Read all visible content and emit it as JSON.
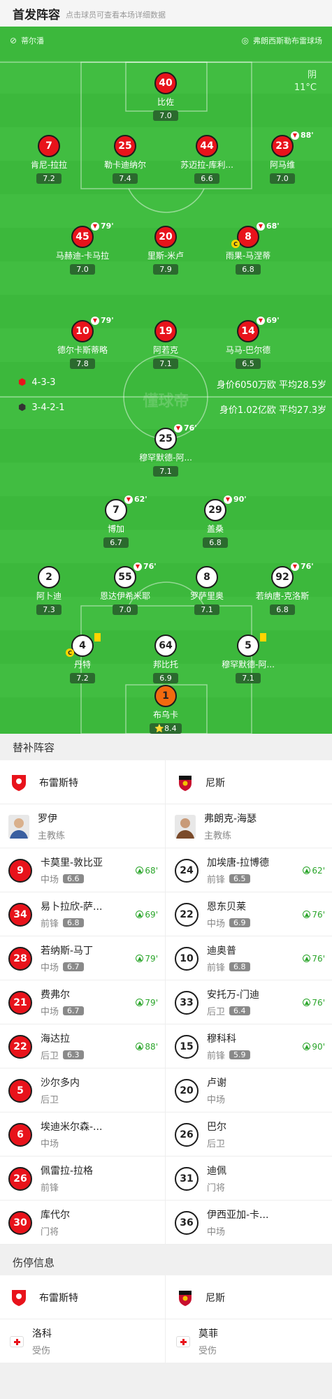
{
  "header": {
    "title": "首发阵容",
    "subtitle": "点击球员可查看本场详细数据"
  },
  "field": {
    "home_team": "蒂尔潘",
    "venue": "弗朗西斯勒布雷球场",
    "weather": "阴",
    "temperature": "11°C",
    "watermark": "懂球帝",
    "home_formation": "4-3-3",
    "home_value": "身价6050万欧 平均28.5岁",
    "away_formation": "3-4-2-1",
    "away_value": "身价1.02亿欧 平均27.3岁"
  },
  "home_players": [
    {
      "num": "40",
      "name": "比佐",
      "rating": "7.0",
      "sub": ""
    },
    {
      "num": "7",
      "name": "肯尼-拉拉",
      "rating": "7.2",
      "sub": ""
    },
    {
      "num": "25",
      "name": "勒卡迪纳尔",
      "rating": "7.4",
      "sub": ""
    },
    {
      "num": "44",
      "name": "苏迈拉-库利...",
      "rating": "6.6",
      "sub": ""
    },
    {
      "num": "23",
      "name": "阿马维",
      "rating": "7.0",
      "sub": "88'"
    },
    {
      "num": "45",
      "name": "马赫迪-卡马拉",
      "rating": "7.0",
      "sub": "79'"
    },
    {
      "num": "20",
      "name": "里斯-米卢",
      "rating": "7.9",
      "sub": ""
    },
    {
      "num": "8",
      "name": "雨果-马涅蒂",
      "rating": "6.8",
      "sub": "68'"
    },
    {
      "num": "10",
      "name": "德尔卡斯蒂略",
      "rating": "7.8",
      "sub": "79'"
    },
    {
      "num": "19",
      "name": "阿若克",
      "rating": "7.1",
      "sub": ""
    },
    {
      "num": "14",
      "name": "马马-巴尔德",
      "rating": "6.5",
      "sub": "69'"
    }
  ],
  "away_players": [
    {
      "num": "25",
      "name": "穆罕默德-阿...",
      "rating": "7.1",
      "sub": "76'"
    },
    {
      "num": "7",
      "name": "博加",
      "rating": "6.7",
      "sub": "62'"
    },
    {
      "num": "29",
      "name": "盖桑",
      "rating": "6.8",
      "sub": "90'"
    },
    {
      "num": "2",
      "name": "阿卜迪",
      "rating": "7.3",
      "sub": ""
    },
    {
      "num": "55",
      "name": "恩达伊希米耶",
      "rating": "7.0",
      "sub": "76'"
    },
    {
      "num": "8",
      "name": "罗萨里奥",
      "rating": "7.1",
      "sub": ""
    },
    {
      "num": "92",
      "name": "若纳唐-克洛斯",
      "rating": "6.8",
      "sub": "76'"
    },
    {
      "num": "4",
      "name": "丹特",
      "rating": "7.2",
      "sub": ""
    },
    {
      "num": "64",
      "name": "邦比托",
      "rating": "6.9",
      "sub": ""
    },
    {
      "num": "5",
      "name": "穆罕默德-阿...",
      "rating": "7.1",
      "sub": ""
    },
    {
      "num": "1",
      "name": "布乌卡",
      "rating": "8.4",
      "sub": ""
    }
  ],
  "subs": {
    "title": "替补阵容",
    "home_team": "布雷斯特",
    "away_team": "尼斯",
    "home_coach": {
      "name": "罗伊",
      "role": "主教练"
    },
    "away_coach": {
      "name": "弗朗克-海瑟",
      "role": "主教练"
    },
    "rows": [
      {
        "hn": "9",
        "hname": "卡莫里-敦比亚",
        "hpos": "中场",
        "hr": "6.6",
        "hs": "68'",
        "an": "24",
        "aname": "加埃唐-拉博德",
        "apos": "前锋",
        "ar": "6.5",
        "as": "62'"
      },
      {
        "hn": "34",
        "hname": "易卜拉欣-萨...",
        "hpos": "前锋",
        "hr": "6.8",
        "hs": "69'",
        "an": "22",
        "aname": "恩东贝莱",
        "apos": "中场",
        "ar": "6.9",
        "as": "76'"
      },
      {
        "hn": "28",
        "hname": "若纳斯-马丁",
        "hpos": "中场",
        "hr": "6.7",
        "hs": "79'",
        "an": "10",
        "aname": "迪奥普",
        "apos": "前锋",
        "ar": "6.8",
        "as": "76'"
      },
      {
        "hn": "21",
        "hname": "费弗尔",
        "hpos": "中场",
        "hr": "6.7",
        "hs": "79'",
        "an": "33",
        "aname": "安托万-门迪",
        "apos": "后卫",
        "ar": "6.4",
        "as": "76'"
      },
      {
        "hn": "22",
        "hname": "海达拉",
        "hpos": "后卫",
        "hr": "6.3",
        "hs": "88'",
        "an": "15",
        "aname": "穆科科",
        "apos": "前锋",
        "ar": "5.9",
        "as": "90'"
      },
      {
        "hn": "5",
        "hname": "沙尔多内",
        "hpos": "后卫",
        "hr": "",
        "hs": "",
        "an": "20",
        "aname": "卢谢",
        "apos": "中场",
        "ar": "",
        "as": ""
      },
      {
        "hn": "6",
        "hname": "埃迪米尔森-...",
        "hpos": "中场",
        "hr": "",
        "hs": "",
        "an": "26",
        "aname": "巴尔",
        "apos": "后卫",
        "ar": "",
        "as": ""
      },
      {
        "hn": "26",
        "hname": "佩雷拉-拉格",
        "hpos": "前锋",
        "hr": "",
        "hs": "",
        "an": "31",
        "aname": "迪佩",
        "apos": "门将",
        "ar": "",
        "as": ""
      },
      {
        "hn": "30",
        "hname": "库代尔",
        "hpos": "门将",
        "hr": "",
        "hs": "",
        "an": "36",
        "aname": "伊西亚加-卡...",
        "apos": "中场",
        "ar": "",
        "as": ""
      }
    ]
  },
  "injuries": {
    "title": "伤停信息",
    "home_team": "布雷斯特",
    "away_team": "尼斯",
    "home_player": {
      "name": "洛科",
      "status": "受伤"
    },
    "away_player": {
      "name": "莫菲",
      "status": "受伤"
    }
  }
}
